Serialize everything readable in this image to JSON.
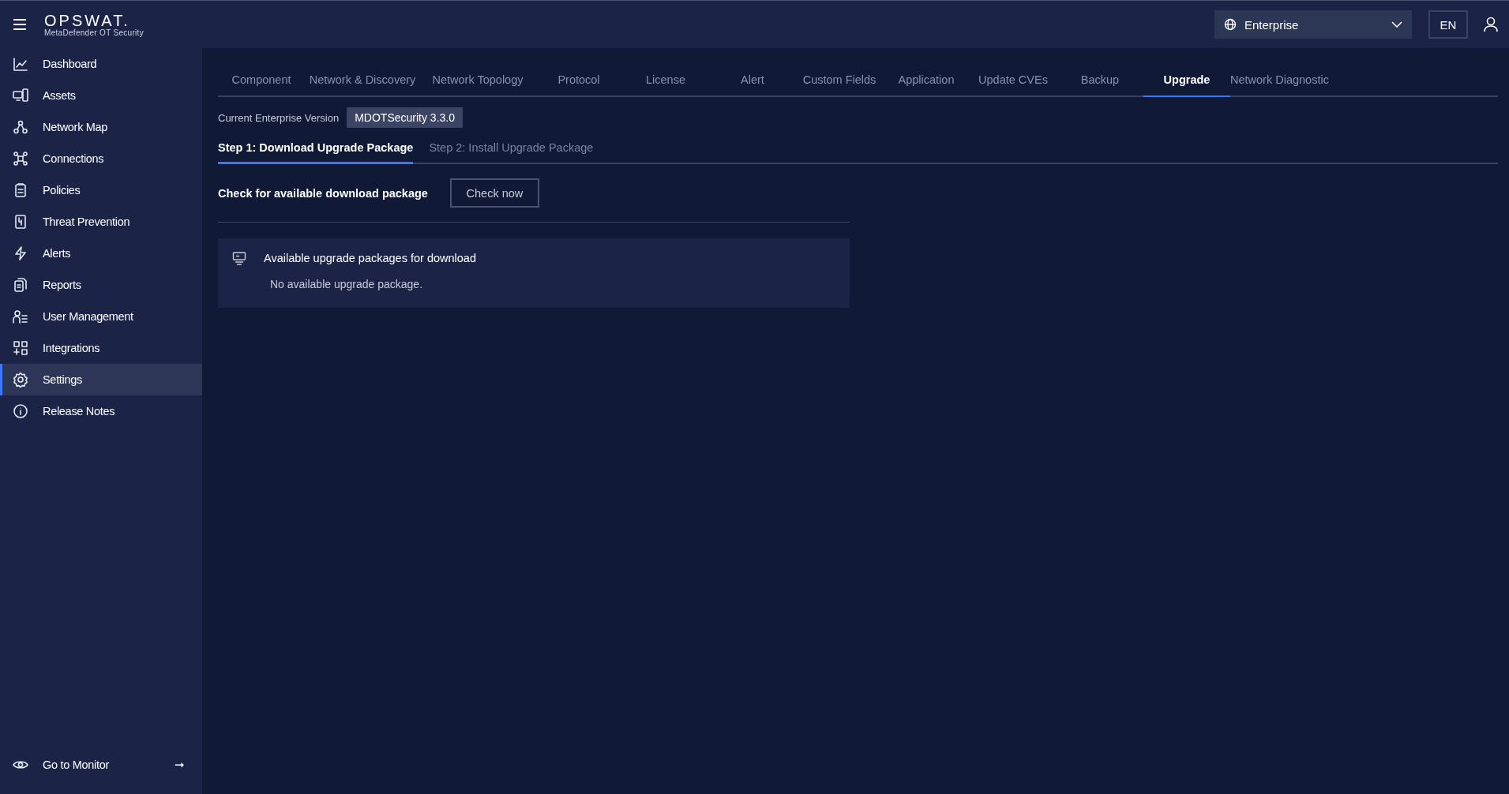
{
  "header": {
    "brand": "OPSWAT.",
    "product": "MetaDefender OT Security",
    "site_select": "Enterprise",
    "language": "EN"
  },
  "sidebar": {
    "items": [
      {
        "label": "Dashboard",
        "selected": false
      },
      {
        "label": "Assets",
        "selected": false
      },
      {
        "label": "Network Map",
        "selected": false
      },
      {
        "label": "Connections",
        "selected": false
      },
      {
        "label": "Policies",
        "selected": false
      },
      {
        "label": "Threat Prevention",
        "selected": false
      },
      {
        "label": "Alerts",
        "selected": false
      },
      {
        "label": "Reports",
        "selected": false
      },
      {
        "label": "User Management",
        "selected": false
      },
      {
        "label": "Integrations",
        "selected": false
      },
      {
        "label": "Settings",
        "selected": true
      },
      {
        "label": "Release Notes",
        "selected": false
      }
    ],
    "footer": {
      "label": "Go to Monitor",
      "arrow": "➞"
    }
  },
  "tabs": [
    {
      "label": "Component",
      "selected": false
    },
    {
      "label": "Network & Discovery",
      "selected": false
    },
    {
      "label": "Network Topology",
      "selected": false
    },
    {
      "label": "Protocol",
      "selected": false
    },
    {
      "label": "License",
      "selected": false
    },
    {
      "label": "Alert",
      "selected": false
    },
    {
      "label": "Custom Fields",
      "selected": false
    },
    {
      "label": "Application",
      "selected": false
    },
    {
      "label": "Update CVEs",
      "selected": false
    },
    {
      "label": "Backup",
      "selected": false
    },
    {
      "label": "Upgrade",
      "selected": true
    },
    {
      "label": "Network Diagnostic",
      "selected": false
    }
  ],
  "version": {
    "label": "Current Enterprise Version",
    "value": "MDOTSecurity 3.3.0"
  },
  "steps": [
    {
      "label": "Step 1: Download Upgrade Package",
      "selected": true
    },
    {
      "label": "Step 2: Install Upgrade Package",
      "selected": false
    }
  ],
  "check": {
    "label": "Check for available download package",
    "button": "Check now"
  },
  "packages": {
    "title": "Available upgrade packages for download",
    "message": "No available upgrade package."
  }
}
